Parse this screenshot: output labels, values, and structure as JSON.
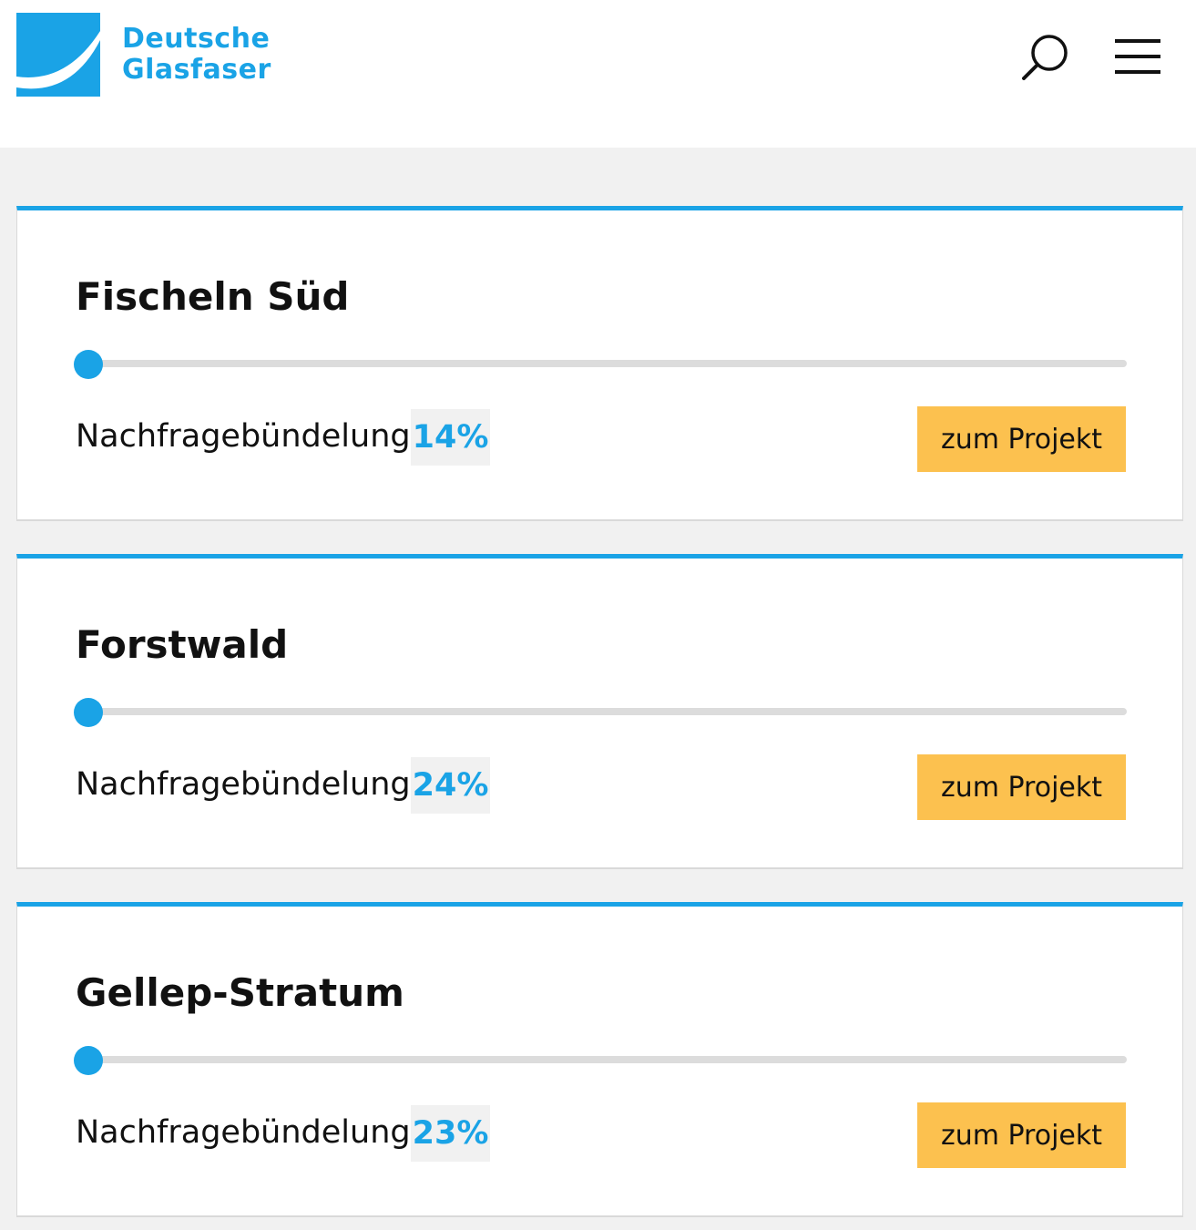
{
  "header": {
    "logo_line1": "Deutsche",
    "logo_line2": "Glasfaser",
    "search_icon": "search-icon",
    "menu_icon": "hamburger-menu-icon"
  },
  "colors": {
    "accent": "#1aa3e6",
    "button": "#fcc14f",
    "track": "#dcdcdc",
    "background": "#f1f1f1"
  },
  "projects": [
    {
      "name": "Fischeln Süd",
      "label": "Nachfragebündelung",
      "percent_text": "14%",
      "progress": 0.14,
      "button": "zum Projekt"
    },
    {
      "name": "Forstwald",
      "label": "Nachfragebündelung",
      "percent_text": "24%",
      "progress": 0.24,
      "button": "zum Projekt"
    },
    {
      "name": "Gellep-Stratum",
      "label": "Nachfragebündelung",
      "percent_text": "23%",
      "progress": 0.23,
      "button": "zum Projekt"
    }
  ]
}
